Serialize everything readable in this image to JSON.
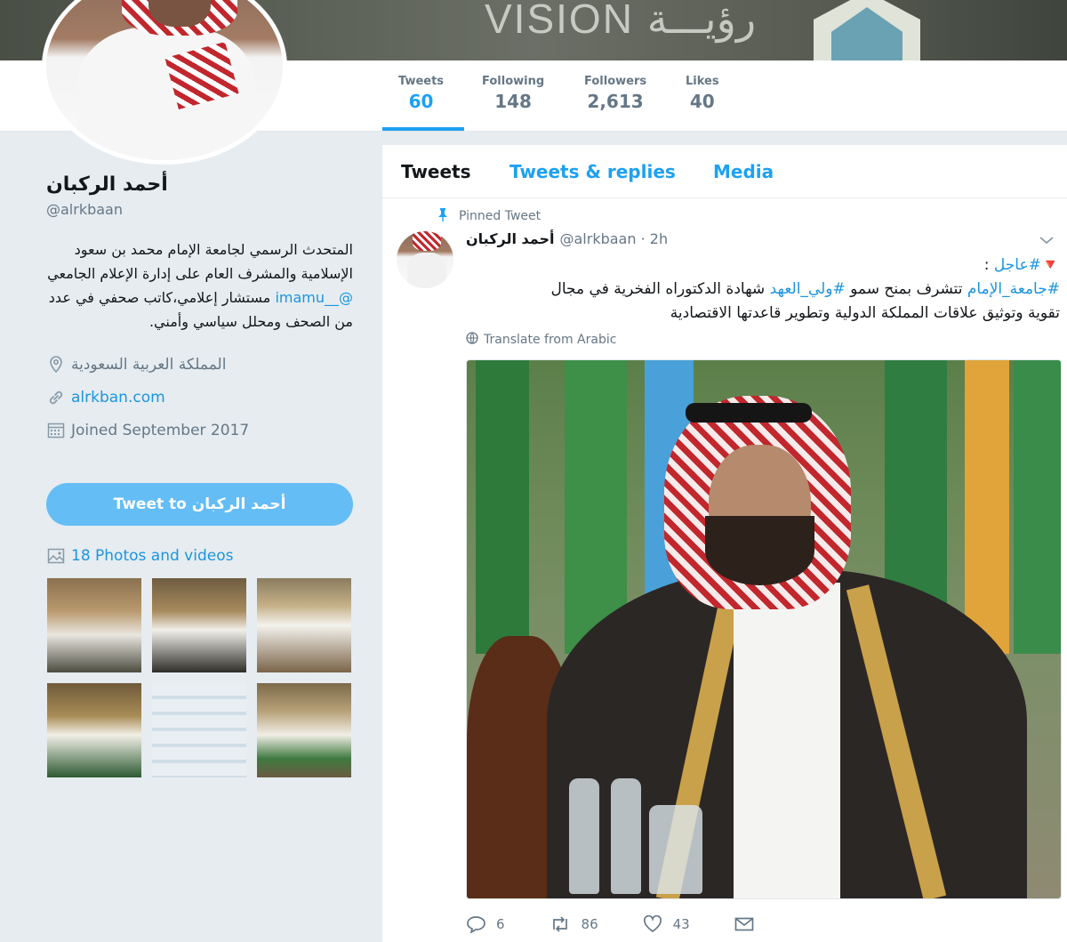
{
  "banner": {
    "text": "VISION رؤيـــة"
  },
  "stats": [
    {
      "label": "Tweets",
      "value": "60"
    },
    {
      "label": "Following",
      "value": "148"
    },
    {
      "label": "Followers",
      "value": "2,613"
    },
    {
      "label": "Likes",
      "value": "40"
    }
  ],
  "profile": {
    "name": "أحمد الركبان",
    "handle": "@alrkbaan",
    "bio_before": "المتحدث الرسمي لجامعة الإمام محمد بن سعود الإسلامية والمشرف العام على إدارة الإعلام الجامعي ",
    "bio_mention": "@__imamu",
    "bio_after": " مستشار إعلامي،كاتب صحفي في عدد من الصحف ومحلل سياسي وأمني.",
    "location": "المملكة العربية السعودية",
    "website": "alrkban.com",
    "joined": "Joined September 2017",
    "tweet_to": "Tweet to أحمد الركبان",
    "photos_link": "18 Photos and videos"
  },
  "tabs": [
    {
      "label": "Tweets"
    },
    {
      "label": "Tweets & replies"
    },
    {
      "label": "Media"
    }
  ],
  "tweet": {
    "pinned_label": "Pinned Tweet",
    "author_name": "أحمد الركبان",
    "author_handle": "@alrkbaan · 2h",
    "line1_flag": "🔻",
    "line1_tag": "#عاجل",
    "line1_rest": " :",
    "line2_tag1": "#جامعة_الإمام",
    "line2_mid": " تتشرف بمنح سمو ",
    "line2_tag2": "#ولي_العهد",
    "line2_rest": " شهادة الدكتوراه الفخرية في مجال",
    "line3": "تقوية وتوثيق علاقات المملكة الدولية وتطوير قاعدتها الاقتصادية",
    "translate": "Translate from Arabic",
    "replies": "6",
    "retweets": "86",
    "likes": "43"
  },
  "colors": {
    "accent": "#1da1f2",
    "button": "#64bdf5",
    "text": "#14171a",
    "muted": "#657786"
  }
}
